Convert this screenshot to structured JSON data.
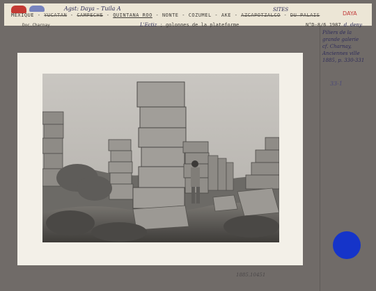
{
  "header": {
    "country": "MEXIQUE",
    "struck_1": "YUCATAN",
    "struck_2": "CAMPECHE",
    "state": "QUINTANA ROO",
    "struck_3": "NONTE",
    "place_2": "COZUMEL",
    "place_3": "AKE",
    "struck_4": "AZCAPOTZALCO",
    "struck_5": "DU PALAIS",
    "handwritten_top": "Agst: Daya – Tuila A",
    "handwritten_sites": "SITES",
    "handwritten_red": "DAYA",
    "source": "Doc.Charnay",
    "caption_handwritten": "L'Ectiz",
    "caption": "; golonnes de la plateforme",
    "ref_code": "N°D-8/6 1987",
    "ref_author": "d. deny"
  },
  "side_note": {
    "lines": [
      "Piliers de la",
      "grande galerie",
      "cf. Charnay,",
      "Anciennes ville",
      "1885, p. 330-331"
    ]
  },
  "side_ref": "33-1",
  "bottom_ref": "1885.10451",
  "colors": {
    "blue_sticker": "#1534c9",
    "red_sticker": "#c43a33",
    "card_background": "#706b68",
    "mat": "#f3f0e8"
  }
}
